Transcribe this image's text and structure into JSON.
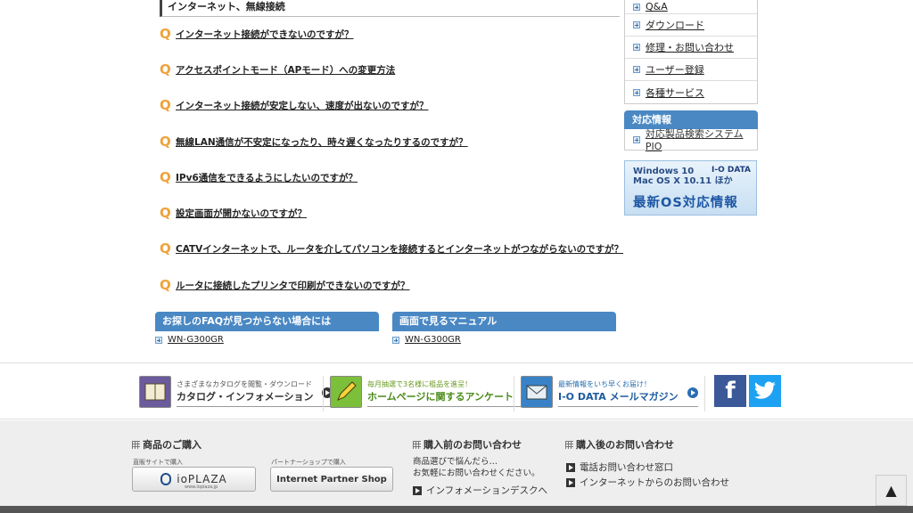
{
  "section_title": "インターネット、無線接続",
  "faq_items": [
    "インターネット接続ができないのですが？",
    "アクセスポイントモード（APモード）への変更方法",
    "インターネット接続が安定しない、速度が出ないのですが？",
    "無線LAN通信が不安定になったり、時々遅くなったりするのですが？",
    "IPv6通信をできるようにしたいのですが？",
    "設定画面が開かないのですが？",
    "CATVインターネットで、ルータを介してパソコンを接続するとインターネットがつながらないのですが？",
    "ルータに接続したプリンタで印刷ができないのですが？"
  ],
  "faq_marker": "Q",
  "boxes": {
    "not_found": {
      "title": "お探しのFAQが見つからない場合には",
      "link": "WN-G300GR"
    },
    "manual": {
      "title": "画面で見るマニュアル",
      "link": "WN-G300GR"
    }
  },
  "sidebar": {
    "items": [
      "Q&A",
      "ダウンロード",
      "修理・お問い合わせ",
      "ユーザー登録",
      "各種サービス"
    ],
    "support_title": "対応情報",
    "support_link": "対応製品検索システムPIO",
    "os_banner": {
      "line1": "Windows 10",
      "line2": "Mac OS X 10.11 ほか",
      "brand": "I-O DATA",
      "main": "最新OS対応情報"
    }
  },
  "banners": [
    {
      "sub": "さまざまなカタログを閲覧・ダウンロード",
      "title": "カタログ・インフォメーション",
      "icon": "catalog-icon"
    },
    {
      "sub": "毎月抽選で3名様に粗品を進呈！",
      "title": "ホームページに関するアンケート",
      "icon": "pencil-icon"
    },
    {
      "sub": "最新情報をいち早くお届け！",
      "title": "I-O DATA メールマガジン",
      "icon": "mail-icon"
    }
  ],
  "sns": {
    "facebook": "f",
    "twitter": "t"
  },
  "footer": {
    "products": {
      "title": "商品のご購入",
      "direct_label": "直販サイトで購入",
      "direct_button": "ioPLAZA",
      "direct_url_text": "www.ioplaza.jp",
      "partner_label": "パートナーショップで購入",
      "partner_button": "Internet Partner Shop"
    },
    "pre_purchase": {
      "title": "購入前のお問い合わせ",
      "line1": "商品選びで悩んだら…",
      "line2": "お気軽にお問い合わせください。",
      "link": "インフォメーションデスクへ"
    },
    "post_purchase": {
      "title": "購入後のお問い合わせ",
      "link1": "電話お問い合わせ窓口",
      "link2": "インターネットからのお問い合わせ"
    }
  },
  "to_top": "▲",
  "colors": {
    "accent_blue": "#4a88c4",
    "q_orange": "#f0a23c",
    "facebook": "#3b5998",
    "twitter": "#1da1f2"
  }
}
